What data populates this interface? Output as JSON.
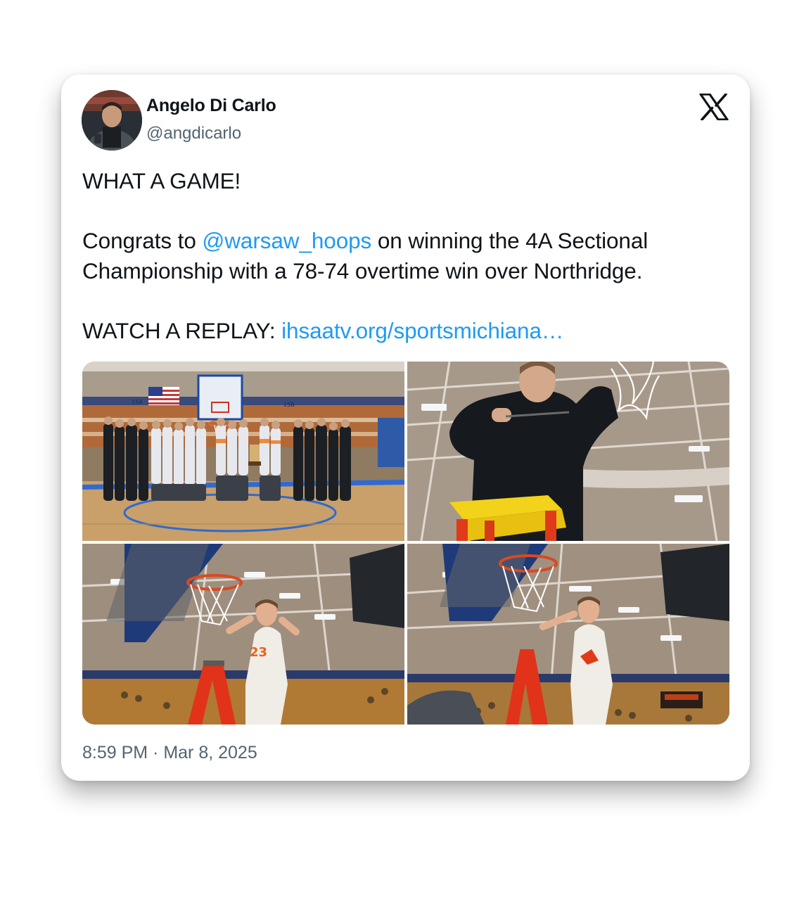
{
  "tweet": {
    "author_name": "Angelo Di Carlo",
    "author_handle": "@angdicarlo",
    "text_line1": "WHAT A GAME!",
    "text_congrats_prefix": "Congrats to ",
    "mention": "@warsaw_hoops",
    "text_congrats_suffix": " on winning the 4A Sectional Championship with a 78-74 overtime win over Northridge.",
    "replay_prefix": "WATCH A REPLAY: ",
    "replay_link": "ihsaatv.org/sportsmichiana…",
    "timestamp": "8:59 PM · Mar 8, 2025"
  },
  "photos": {
    "team_banner_left": "15A",
    "team_banner_right": "15B"
  },
  "icons": {
    "platform_logo": "x-logo-icon",
    "avatar": "avatar-photo"
  },
  "colors": {
    "link": "#1d9bf0",
    "secondary_text": "#536471",
    "primary_text": "#0f1419"
  }
}
